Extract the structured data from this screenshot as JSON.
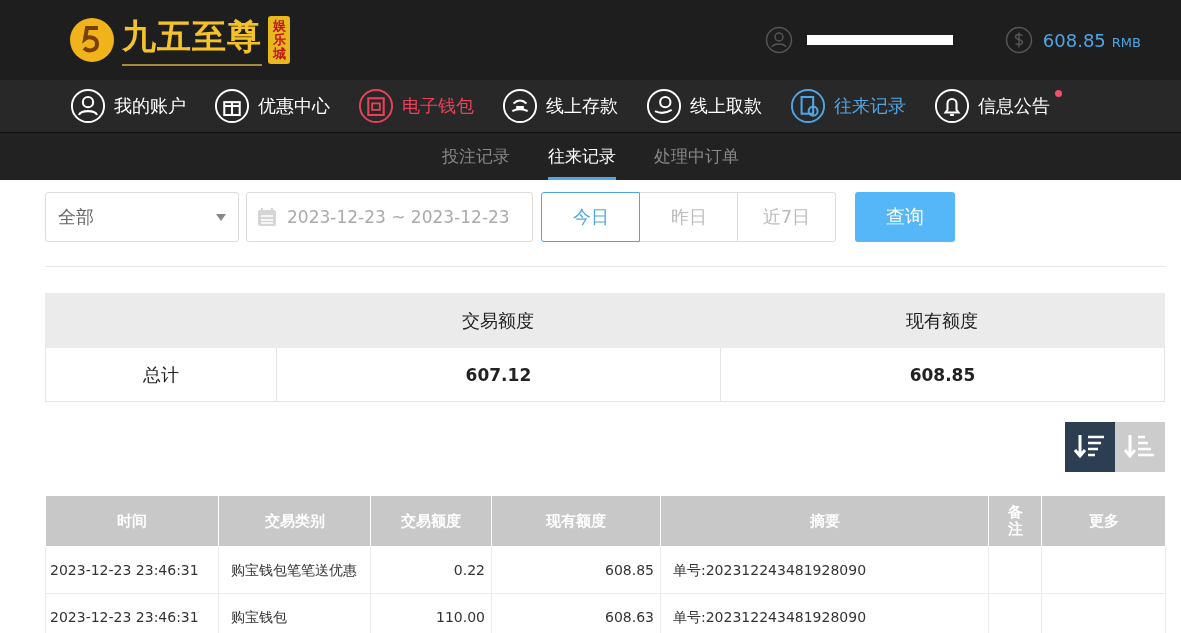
{
  "logo": {
    "title": "九五至尊",
    "badge": "娱乐城"
  },
  "account": {
    "balance": "608.85",
    "currency": "RMB"
  },
  "nav": [
    {
      "label": "我的账户",
      "color": "#ffffff",
      "badge": false
    },
    {
      "label": "优惠中心",
      "color": "#ffffff",
      "badge": false
    },
    {
      "label": "电子钱包",
      "color": "#e8425a",
      "badge": false
    },
    {
      "label": "线上存款",
      "color": "#ffffff",
      "badge": false
    },
    {
      "label": "线上取款",
      "color": "#ffffff",
      "badge": false
    },
    {
      "label": "往来记录",
      "color": "#4ea6e6",
      "badge": false
    },
    {
      "label": "信息公告",
      "color": "#ffffff",
      "badge": true
    }
  ],
  "subtabs": [
    {
      "label": "投注记录",
      "selected": false
    },
    {
      "label": "往来记录",
      "selected": true
    },
    {
      "label": "处理中订单",
      "selected": false
    }
  ],
  "filter": {
    "type": "全部",
    "date_range": "2023-12-23 ~ 2023-12-23",
    "ranges": [
      {
        "label": "今日",
        "selected": true
      },
      {
        "label": "昨日",
        "selected": false
      },
      {
        "label": "近7日",
        "selected": false
      }
    ],
    "query": "查询"
  },
  "summary": {
    "columns": [
      "交易额度",
      "现有额度"
    ],
    "label": "总计",
    "values": [
      "607.12",
      "608.85"
    ]
  },
  "sort": [
    {
      "selected": true
    },
    {
      "selected": false
    }
  ],
  "table": {
    "columns": [
      "时间",
      "交易类别",
      "交易额度",
      "现有额度",
      "摘要",
      "备注",
      "更多"
    ],
    "rows": [
      [
        "2023-12-23 23:46:31",
        "购宝钱包笔笔送优惠",
        "0.22",
        "608.85",
        "单号:202312243481928090",
        "",
        ""
      ],
      [
        "2023-12-23 23:46:31",
        "购宝钱包",
        "110.00",
        "608.63",
        "单号:202312243481928090",
        "",
        ""
      ]
    ]
  }
}
